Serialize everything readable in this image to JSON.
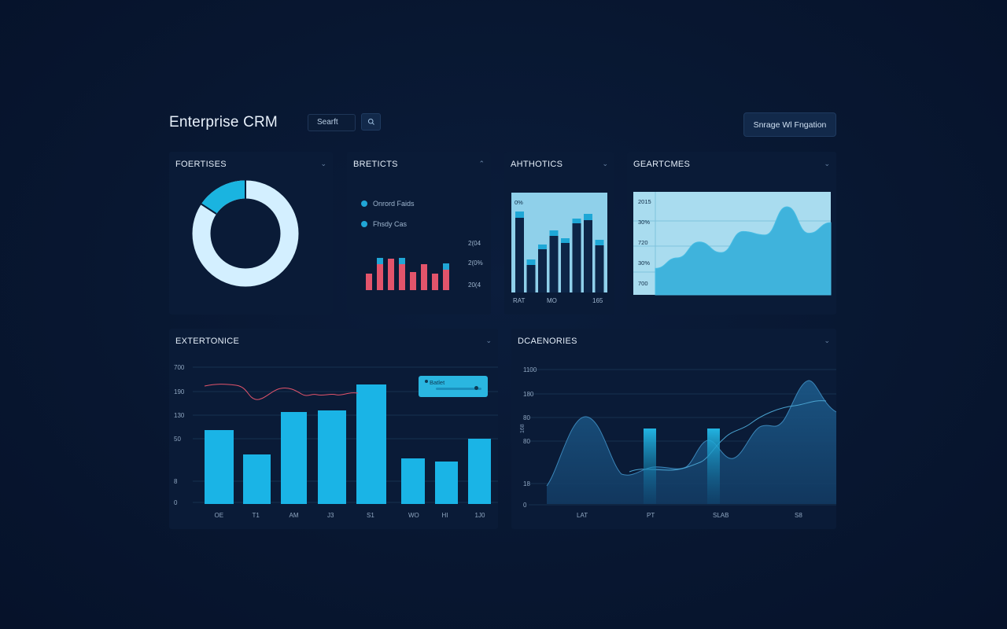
{
  "header": {
    "app_title": "Enterprise CRM",
    "search_placeholder": "Searft",
    "action_button": "Snrage Wl Fngation"
  },
  "icons": {
    "search": "search-icon",
    "collapse": "chevron-icon"
  },
  "colors": {
    "accent": "#20a6d6",
    "bar_red": "#e2546b",
    "background": "#081731",
    "panel": "#0a1b37"
  },
  "panels": {
    "p1": {
      "title": "FOERTISES"
    },
    "p2": {
      "title": "BRETICTS",
      "legend": [
        "Onrord Faids",
        "Fhsdy Cas"
      ],
      "ticks": [
        "2(04",
        "2(0%",
        "20(4"
      ]
    },
    "p3": {
      "title": "AHTHOTICS",
      "ylabel": "0%",
      "xticks": [
        "RAT",
        "MO",
        "165"
      ]
    },
    "p4": {
      "title": "GEARTCMES",
      "yticks": [
        "2015",
        "30%",
        "720",
        "30%",
        "700"
      ]
    },
    "p5": {
      "title": "EXTERTONICE",
      "yticks": [
        "700",
        "190",
        "130",
        "50",
        "8",
        "0"
      ],
      "xticks": [
        "OE",
        "T1",
        "AM",
        "J3",
        "S1",
        "WO",
        "HI",
        "1J0"
      ],
      "tooltip": "Batlet"
    },
    "p6": {
      "title": "DCAENORIES",
      "yticks": [
        "1100",
        "180",
        "80",
        "80",
        "18",
        "0"
      ],
      "ylabel": "168",
      "xticks": [
        "LAT",
        "PT",
        "SLAB",
        "S8"
      ]
    }
  },
  "chart_data": [
    {
      "type": "pie",
      "title": "FOERTISES",
      "slices": [
        {
          "value": 15,
          "color": "#1ab4e0"
        },
        {
          "value": 85,
          "color": "#d3efff"
        }
      ]
    },
    {
      "type": "bar",
      "title": "BRETICTS",
      "values": [
        21,
        33,
        40,
        33,
        23,
        33,
        21,
        26
      ]
    },
    {
      "type": "bar",
      "title": "AHTHOTICS",
      "values": [
        95,
        35,
        55,
        72,
        63,
        88,
        92,
        60
      ],
      "caps": [
        8,
        7,
        6,
        7,
        6,
        6,
        8,
        7
      ]
    },
    {
      "type": "area",
      "title": "GEARTCMES",
      "values": [
        30,
        42,
        60,
        48,
        72,
        68,
        100,
        70,
        82
      ]
    },
    {
      "type": "bar",
      "title": "EXTERTONICE",
      "categories": [
        "OE",
        "T1",
        "AM",
        "J3",
        "S1",
        "WO",
        "HI",
        "1J0"
      ],
      "values": [
        94,
        63,
        117,
        119,
        152,
        58,
        54,
        83
      ]
    },
    {
      "type": "area",
      "title": "DCAENORIES",
      "values": [
        20,
        60,
        110,
        85,
        40,
        45,
        40,
        55,
        90,
        65,
        100,
        160,
        115
      ]
    }
  ]
}
